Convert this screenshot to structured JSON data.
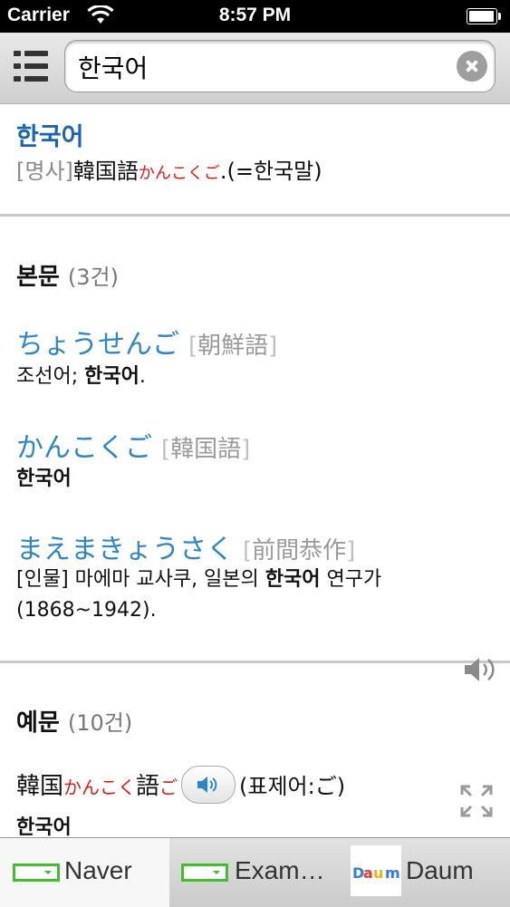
{
  "status": {
    "carrier": "Carrier",
    "time": "8:57 PM"
  },
  "search": {
    "query": "한국어"
  },
  "entry": {
    "headword": "한국어",
    "pos": "[명사]",
    "kanji": "韓国語",
    "reading": "かんこくご",
    "rest": ".(=한국말)"
  },
  "body_section": {
    "title": "본문",
    "count": "(3건)",
    "items": [
      {
        "word": "ちょうせんご",
        "kanji": "朝鮮語",
        "meaning_pre": "조선어; ",
        "meaning_bold": "한국어",
        "meaning_post": "."
      },
      {
        "word": "かんこくご",
        "kanji": "韓国語",
        "meaning_pre": "",
        "meaning_bold": "한국어",
        "meaning_post": ""
      },
      {
        "word": "まえまきょうさく",
        "kanji": "前間恭作",
        "meaning_pre": "[인물] 마에마 교사쿠, 일본의 ",
        "meaning_bold": "한국어",
        "meaning_post": " 연구가",
        "meaning_line2": "(1868~1942)."
      }
    ]
  },
  "examples": {
    "title": "예문",
    "count": "(10건)",
    "line": {
      "k1": "韓国",
      "r1": "かんこく",
      "k2": "語",
      "r2": "ご",
      "note": "(표제어:ご)"
    },
    "translation": "한국어"
  },
  "tabs": [
    {
      "label": "Naver"
    },
    {
      "label": "Exam…"
    },
    {
      "label": "Daum"
    }
  ]
}
